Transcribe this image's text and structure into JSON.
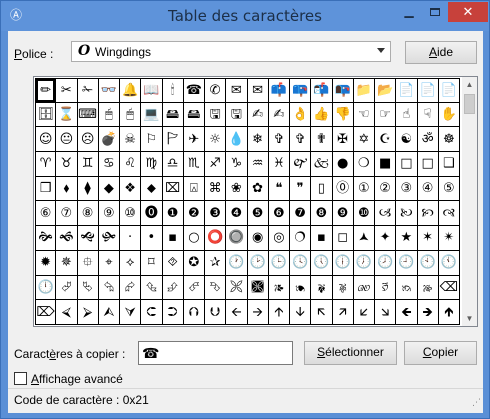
{
  "window": {
    "title": "Table des caractères",
    "icon": "character-map-icon"
  },
  "controls": {
    "minimize": "minimize-icon",
    "maximize": "maximize-icon",
    "close": "close-icon"
  },
  "font": {
    "label_pre": "",
    "label_u": "P",
    "label_post": "olice :",
    "glyph": "O",
    "selected": "Wingdings"
  },
  "help": {
    "label_u": "A",
    "label_post": "ide"
  },
  "grid": {
    "cells": [
      "✏",
      "✂",
      "✁",
      "👓",
      "🔔",
      "📖",
      "🕯",
      "☎",
      "✆",
      "✉",
      "✉",
      "📫",
      "📪",
      "📬",
      "📭",
      "📁",
      "📂",
      "📄",
      "📄",
      "📄",
      "🗄",
      "⌛",
      "⌨",
      "🖱",
      "🖱",
      "💻",
      "🖴",
      "🖴",
      "🖫",
      "🖫",
      "✍",
      "✍",
      "👌",
      "👍",
      "👎",
      "☜",
      "☞",
      "☝",
      "☟",
      "✋",
      "☺",
      "😐",
      "☹",
      "💣",
      "☠",
      "⚐",
      "🏱",
      "✈",
      "☼",
      "💧",
      "❄",
      "✞",
      "✞",
      "✟",
      "✠",
      "✡",
      "☪",
      "☯",
      "ॐ",
      "☸",
      "♈",
      "♉",
      "♊",
      "♋",
      "♌",
      "♍",
      "♎",
      "♏",
      "♐",
      "♑",
      "♒",
      "♓",
      "🙰",
      "🙵",
      "●",
      "❍",
      "■",
      "□",
      "□",
      "❑",
      "❒",
      "⬧",
      "⧫",
      "◆",
      "❖",
      "⬥",
      "⌧",
      "⍓",
      "⌘",
      "❀",
      "✿",
      "❝",
      "❞",
      "▯",
      "⓪",
      "①",
      "②",
      "③",
      "④",
      "⑤",
      "⑥",
      "⑦",
      "⑧",
      "⑨",
      "⑩",
      "⓿",
      "❶",
      "❷",
      "❸",
      "❹",
      "❺",
      "❻",
      "❼",
      "❽",
      "❾",
      "❿",
      "🙢",
      "🙠",
      "🙡",
      "🙣",
      "🙞",
      "🙜",
      "🙝",
      "🙟",
      "·",
      "•",
      "▪",
      "○",
      "⭕",
      "🔘",
      "◉",
      "◎",
      "🔿",
      "▪",
      "◻",
      "🟂",
      "✦",
      "★",
      "✶",
      "✴",
      "✹",
      "✵",
      "⯐",
      "⌖",
      "⟡",
      "⌑",
      "⯑",
      "✪",
      "✰",
      "🕐",
      "🕑",
      "🕒",
      "🕓",
      "🕔",
      "🕕",
      "🕖",
      "🕗",
      "🕘",
      "🕙",
      "🕚",
      "🕛",
      "⮰",
      "⮱",
      "⮲",
      "⮳",
      "⮴",
      "⮵",
      "⮶",
      "⮷",
      "🙪",
      "🙫",
      "🙕",
      "🙔",
      "🙗",
      "🙖",
      "🙐",
      "🙑",
      "🙒",
      "🙓",
      "⌫",
      "⌦",
      "⮘",
      "⮚",
      "⮙",
      "⮛",
      "⮈",
      "⮊",
      "⮉",
      "⮋",
      "🡨",
      "🡪",
      "🡩",
      "🡫",
      "🡬",
      "🡭",
      "🡯",
      "🡮",
      "🡸",
      "🡺",
      "🡹"
    ]
  },
  "copy": {
    "label_pre": "Caract",
    "label_u": "è",
    "label_post": "res à copier :",
    "value": "☎",
    "select_label_u": "S",
    "select_label_post": "électionner",
    "copy_label_u": "C",
    "copy_label_post": "opier"
  },
  "advanced": {
    "label_pre": "",
    "label_u": "A",
    "label_post": "ffichage avancé",
    "checked": false
  },
  "status": {
    "text": "Code de caractère : 0x21"
  }
}
